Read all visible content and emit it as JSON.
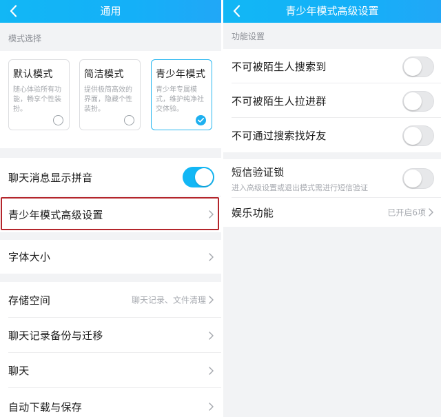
{
  "left": {
    "title": "通用",
    "mode_section_label": "模式选择",
    "modes": [
      {
        "name": "默认模式",
        "desc": "随心体验所有功能，畅享个性装扮。",
        "selected": false
      },
      {
        "name": "简洁模式",
        "desc": "提供极简高效的界面，隐藏个性装扮。",
        "selected": false
      },
      {
        "name": "青少年模式",
        "desc": "青少年专属模式，维护纯净社交体验。",
        "selected": true
      }
    ],
    "rows": {
      "pinyin": {
        "label": "聊天消息显示拼音",
        "toggle": "on"
      },
      "teen_settings": {
        "label": "青少年模式高级设置"
      },
      "font_size": {
        "label": "字体大小"
      },
      "storage": {
        "label": "存储空间",
        "hint": "聊天记录、文件清理"
      },
      "backup": {
        "label": "聊天记录备份与迁移"
      },
      "chat": {
        "label": "聊天"
      },
      "auto_download": {
        "label": "自动下载与保存"
      }
    }
  },
  "right": {
    "title": "青少年模式高级设置",
    "section_label": "功能设置",
    "rows": {
      "no_search": {
        "label": "不可被陌生人搜索到",
        "toggle": "off"
      },
      "no_pull_group": {
        "label": "不可被陌生人拉进群",
        "toggle": "off"
      },
      "no_find_friend": {
        "label": "不可通过搜索找好友",
        "toggle": "off"
      },
      "sms_lock": {
        "label": "短信验证锁",
        "sublabel": "进入高级设置或退出模式需进行短信验证",
        "toggle": "off"
      },
      "entertainment": {
        "label": "娱乐功能",
        "hint": "已开启6项"
      }
    }
  },
  "colors": {
    "titlebar": "#12b7f5",
    "toggle_on": "#12b7f5",
    "highlight_box": "#b4252b",
    "selected_card_border": "#26b6f0"
  },
  "icons": {
    "back": "chevron-left-icon",
    "row_arrow": "chevron-right-icon",
    "check": "check-icon"
  }
}
